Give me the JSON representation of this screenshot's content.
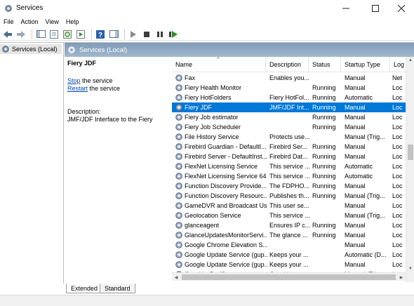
{
  "window": {
    "title": "Services"
  },
  "menu": [
    "File",
    "Action",
    "View",
    "Help"
  ],
  "toolbar": {
    "icons": [
      "back-arrow-icon",
      "forward-arrow-icon",
      "show-hide-console-tree-icon",
      "properties-icon",
      "refresh-icon",
      "export-list-icon",
      "help-icon",
      "show-action-pane-icon",
      "start-service-icon",
      "stop-service-icon",
      "pause-service-icon",
      "restart-service-icon"
    ]
  },
  "tree": {
    "root_label": "Services (Local)"
  },
  "pane": {
    "header_label": "Services (Local)",
    "service_name": "Fiery JDF",
    "stop_link": "Stop",
    "stop_suffix": " the service",
    "restart_link": "Restart",
    "restart_suffix": " the service",
    "description_label": "Description:",
    "description_text": "JMF/JDF Interface to the Fiery"
  },
  "columns": [
    "Name",
    "Description",
    "Status",
    "Startup Type",
    "Log"
  ],
  "selected_row": 3,
  "rows": [
    {
      "name": "Fax",
      "desc": "Enables you...",
      "status": "",
      "startup": "Manual",
      "log": "Net"
    },
    {
      "name": "Fiery Health Monitor",
      "desc": "",
      "status": "Running",
      "startup": "Manual",
      "log": "Loc"
    },
    {
      "name": "Fiery HotFolders",
      "desc": "Fiery HotFol...",
      "status": "Running",
      "startup": "Automatic",
      "log": "Loc"
    },
    {
      "name": "Fiery JDF",
      "desc": "JMF/JDF Int...",
      "status": "Running",
      "startup": "Manual",
      "log": "Loc"
    },
    {
      "name": "Fiery Job estimator",
      "desc": "",
      "status": "Running",
      "startup": "Manual",
      "log": "Loc"
    },
    {
      "name": "Fiery Job Scheduler",
      "desc": "",
      "status": "Running",
      "startup": "Manual",
      "log": "Loc"
    },
    {
      "name": "File History Service",
      "desc": "Protects use...",
      "status": "",
      "startup": "Manual (Trig...",
      "log": "Loc"
    },
    {
      "name": "Firebird Guardian - DefaultI...",
      "desc": "Firebird Ser...",
      "status": "Running",
      "startup": "Manual",
      "log": "Loc"
    },
    {
      "name": "Firebird Server - DefaultInst...",
      "desc": "Firebird Dat...",
      "status": "Running",
      "startup": "Manual",
      "log": "Loc"
    },
    {
      "name": "FlexNet Licensing Service",
      "desc": "This service ...",
      "status": "Running",
      "startup": "Automatic",
      "log": "Loc"
    },
    {
      "name": "FlexNet Licensing Service 64",
      "desc": "This service ...",
      "status": "Running",
      "startup": "Automatic",
      "log": "Loc"
    },
    {
      "name": "Function Discovery Provide...",
      "desc": "The FDPHO...",
      "status": "Running",
      "startup": "Manual",
      "log": "Loc"
    },
    {
      "name": "Function Discovery Resourc...",
      "desc": "Publishes th...",
      "status": "Running",
      "startup": "Manual (Trig...",
      "log": "Loc"
    },
    {
      "name": "GameDVR and Broadcast Us...",
      "desc": "This user se...",
      "status": "",
      "startup": "Manual",
      "log": "Loc"
    },
    {
      "name": "Geolocation Service",
      "desc": "This service ...",
      "status": "",
      "startup": "Manual (Trig...",
      "log": "Loc"
    },
    {
      "name": "glanceagent",
      "desc": "Ensures IP c...",
      "status": "Running",
      "startup": "Manual",
      "log": "Loc"
    },
    {
      "name": "GlanceUpdatesMonitorServi...",
      "desc": "The glance ...",
      "status": "Running",
      "startup": "Manual",
      "log": "Loc"
    },
    {
      "name": "Google Chrome Elevation S...",
      "desc": "",
      "status": "",
      "startup": "Manual",
      "log": "Loc"
    },
    {
      "name": "Google Update Service (gup...",
      "desc": "Keeps your ...",
      "status": "",
      "startup": "Automatic (D...",
      "log": "Loc"
    },
    {
      "name": "Google Update Service (gup...",
      "desc": "Keeps your ...",
      "status": "",
      "startup": "Manual",
      "log": "Loc"
    },
    {
      "name": "GraphicsPerfSvc",
      "desc": "Graphics pe...",
      "status": "",
      "startup": "Manual (Trig...",
      "log": "Loc"
    }
  ],
  "tabs": [
    "Extended",
    "Standard"
  ]
}
